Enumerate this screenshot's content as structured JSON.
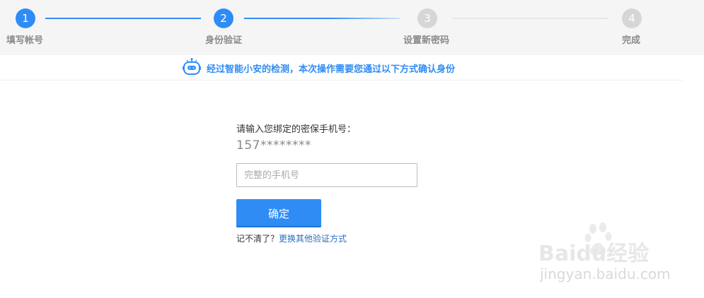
{
  "stepper": {
    "steps": [
      {
        "number": "1",
        "label": "填写帐号",
        "state": "active"
      },
      {
        "number": "2",
        "label": "身份验证",
        "state": "active"
      },
      {
        "number": "3",
        "label": "设置新密码",
        "state": "inactive"
      },
      {
        "number": "4",
        "label": "完成",
        "state": "inactive"
      }
    ]
  },
  "notice": {
    "icon": "robot-icon",
    "text": "经过智能小安的检测，本次操作需要您通过以下方式确认身份"
  },
  "form": {
    "prompt": "请输入您绑定的密保手机号：",
    "masked_phone": "157********",
    "phone_placeholder": "完整的手机号",
    "phone_value": "",
    "confirm_label": "确定",
    "forgot_text": "记不清了？",
    "other_method_link": "更换其他验证方式"
  },
  "watermark": {
    "brand": "Baidu经验",
    "url": "jingyan.baidu.com"
  },
  "colors": {
    "accent": "#2f8cf5",
    "inactive": "#d6d6d6",
    "link": "#2f6ec0"
  }
}
